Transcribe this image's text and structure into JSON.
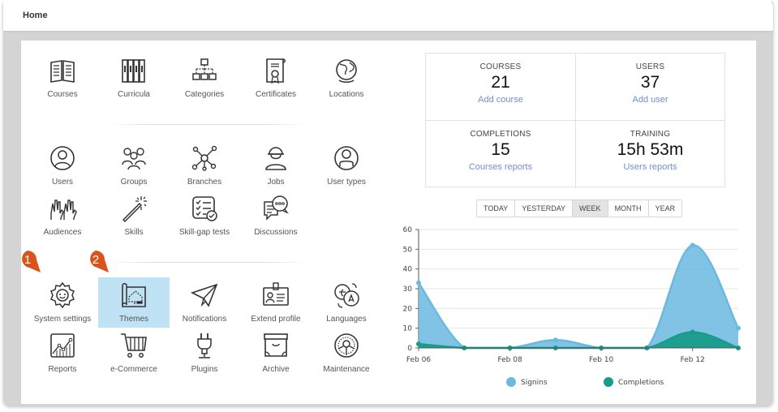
{
  "header": {
    "title": "Home"
  },
  "tiles": [
    {
      "label": "Courses",
      "icon": "book-icon"
    },
    {
      "label": "Curricula",
      "icon": "binders-icon"
    },
    {
      "label": "Categories",
      "icon": "hierarchy-icon"
    },
    {
      "label": "Certificates",
      "icon": "certificate-icon"
    },
    {
      "label": "Locations",
      "icon": "globe-icon"
    },
    {
      "label": "Users",
      "icon": "user-icon"
    },
    {
      "label": "Groups",
      "icon": "group-icon"
    },
    {
      "label": "Branches",
      "icon": "network-icon"
    },
    {
      "label": "Jobs",
      "icon": "worker-icon"
    },
    {
      "label": "User types",
      "icon": "user-type-icon"
    },
    {
      "label": "Audiences",
      "icon": "raised-hands-icon"
    },
    {
      "label": "Skills",
      "icon": "magic-wand-icon"
    },
    {
      "label": "Skill-gap tests",
      "icon": "checklist-icon"
    },
    {
      "label": "Discussions",
      "icon": "chat-icon"
    },
    {
      "label": "System settings",
      "icon": "gear-icon"
    },
    {
      "label": "Themes",
      "icon": "blueprint-icon"
    },
    {
      "label": "Notifications",
      "icon": "paper-plane-icon"
    },
    {
      "label": "Extend profile",
      "icon": "id-badge-icon"
    },
    {
      "label": "Languages",
      "icon": "translate-icon"
    },
    {
      "label": "Reports",
      "icon": "line-chart-icon"
    },
    {
      "label": "e-Commerce",
      "icon": "cart-icon"
    },
    {
      "label": "Plugins",
      "icon": "plug-icon"
    },
    {
      "label": "Archive",
      "icon": "archive-box-icon"
    },
    {
      "label": "Maintenance",
      "icon": "wheel-icon"
    }
  ],
  "selected_tile": "Themes",
  "callouts": [
    {
      "number": "1",
      "target": "System settings",
      "color": "#d9541a"
    },
    {
      "number": "2",
      "target": "Themes",
      "color": "#d9541a"
    }
  ],
  "stats": [
    {
      "heading": "COURSES",
      "value": "21",
      "link": "Add course"
    },
    {
      "heading": "USERS",
      "value": "37",
      "link": "Add user"
    },
    {
      "heading": "COMPLETIONS",
      "value": "15",
      "link": "Courses reports"
    },
    {
      "heading": "TRAINING",
      "value": "15h 53m",
      "link": "Users reports"
    }
  ],
  "range_buttons": [
    {
      "label": "TODAY",
      "active": false
    },
    {
      "label": "YESTERDAY",
      "active": false
    },
    {
      "label": "WEEK",
      "active": true
    },
    {
      "label": "MONTH",
      "active": false
    },
    {
      "label": "YEAR",
      "active": false
    }
  ],
  "chart_data": {
    "type": "area",
    "x": [
      "Feb 06",
      "Feb 07",
      "Feb 08",
      "Feb 09",
      "Feb 10",
      "Feb 11",
      "Feb 12",
      "Feb 13"
    ],
    "xtick_labels": [
      "Feb 06",
      "Feb 08",
      "Feb 10",
      "Feb 12"
    ],
    "series": [
      {
        "name": "Signins",
        "color": "#6bb9e0",
        "values": [
          33,
          0,
          0,
          4,
          0,
          0,
          52,
          10
        ]
      },
      {
        "name": "Completions",
        "color": "#189c8a",
        "values": [
          2,
          0,
          0,
          0,
          0,
          0,
          8,
          0
        ]
      }
    ],
    "ylim": [
      0,
      60
    ],
    "yticks": [
      0,
      10,
      20,
      30,
      40,
      50,
      60
    ],
    "grid": true,
    "legend": "bottom",
    "title": "",
    "xlabel": "",
    "ylabel": ""
  }
}
